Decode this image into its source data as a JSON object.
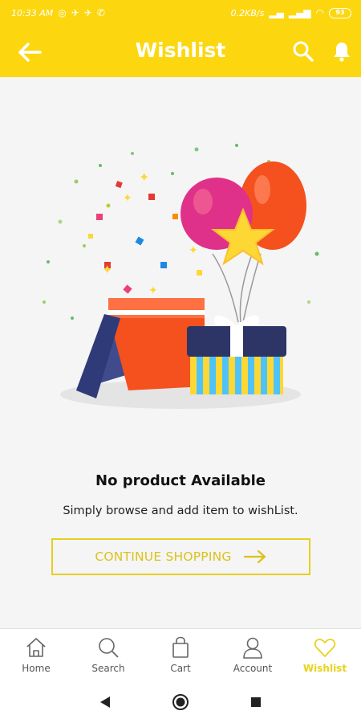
{
  "status_bar": {
    "time": "10:33 AM",
    "network_speed": "0.2KB/s",
    "battery": "93"
  },
  "app_bar": {
    "title": "Wishlist",
    "back_icon": "arrow-left-icon",
    "search_icon": "search-icon",
    "notification_icon": "bell-icon"
  },
  "empty_state": {
    "illustration": "gift-box-balloons-illustration",
    "title": "No product Available",
    "subtitle": "Simply browse and add item to wishList.",
    "button_label": "CONTINUE SHOPPING"
  },
  "bottom_nav": {
    "items": [
      {
        "label": "Home",
        "icon": "home-icon",
        "active": false
      },
      {
        "label": "Search",
        "icon": "search-icon",
        "active": false
      },
      {
        "label": "Cart",
        "icon": "cart-icon",
        "active": false
      },
      {
        "label": "Account",
        "icon": "account-icon",
        "active": false
      },
      {
        "label": "Wishlist",
        "icon": "heart-icon",
        "active": true
      }
    ]
  },
  "colors": {
    "primary": "#fcd710",
    "accent_text": "#dcc21a",
    "background": "#f5f5f5"
  }
}
